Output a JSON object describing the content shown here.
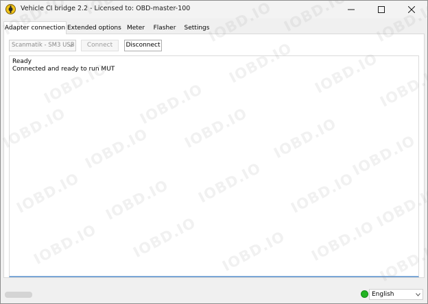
{
  "window": {
    "title": "Vehicle CI bridge  2.2 - Licensed to: OBD-master-100"
  },
  "tabs": [
    {
      "label": "Adapter connection",
      "active": true
    },
    {
      "label": "Extended options",
      "active": false
    },
    {
      "label": "Meter",
      "active": false
    },
    {
      "label": "Flasher",
      "active": false
    },
    {
      "label": "Settings",
      "active": false
    }
  ],
  "connection": {
    "adapter_selected": "Scanmatik - SM3 USB",
    "connect_label": "Connect",
    "disconnect_label": "Disconnect"
  },
  "log": {
    "lines": [
      "Ready",
      "Connected and ready to run MUT"
    ]
  },
  "watermark": "IOBD.IO",
  "status": {
    "indicator_color": "#22b322",
    "language": "English"
  }
}
